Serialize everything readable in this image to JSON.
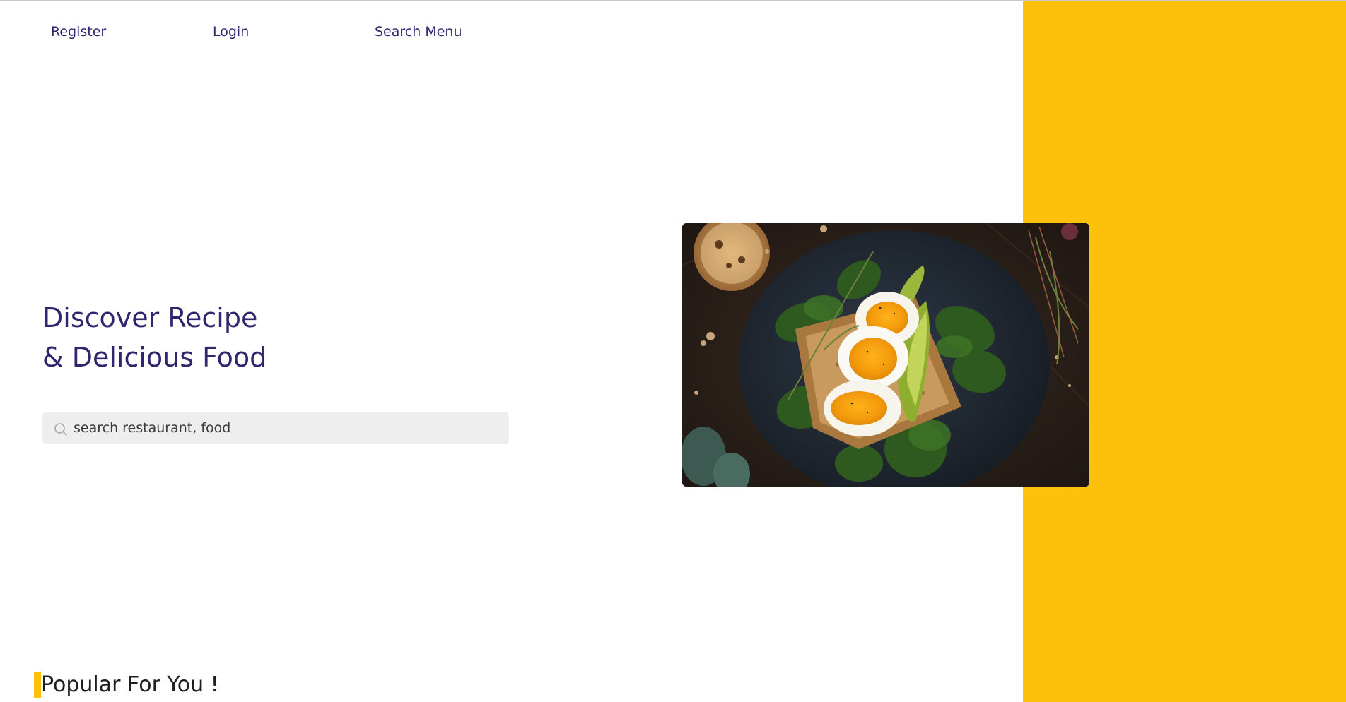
{
  "nav": {
    "register_label": "Register",
    "login_label": "Login",
    "search_menu_label": "Search Menu"
  },
  "hero": {
    "title_line1": "Discover Recipe",
    "title_line2": "& Delicious Food",
    "search": {
      "placeholder": "search restaurant, food",
      "value": "",
      "icon": "search-icon"
    },
    "image": {
      "subject": "toast-with-boiled-eggs-avocado-spinach"
    }
  },
  "popular": {
    "heading": "Popular For You !"
  },
  "colors": {
    "accent": "#FDC00B",
    "primary_text": "#2E266F",
    "search_bg": "#EEEEEE",
    "heading_text": "#1F1F1F"
  }
}
